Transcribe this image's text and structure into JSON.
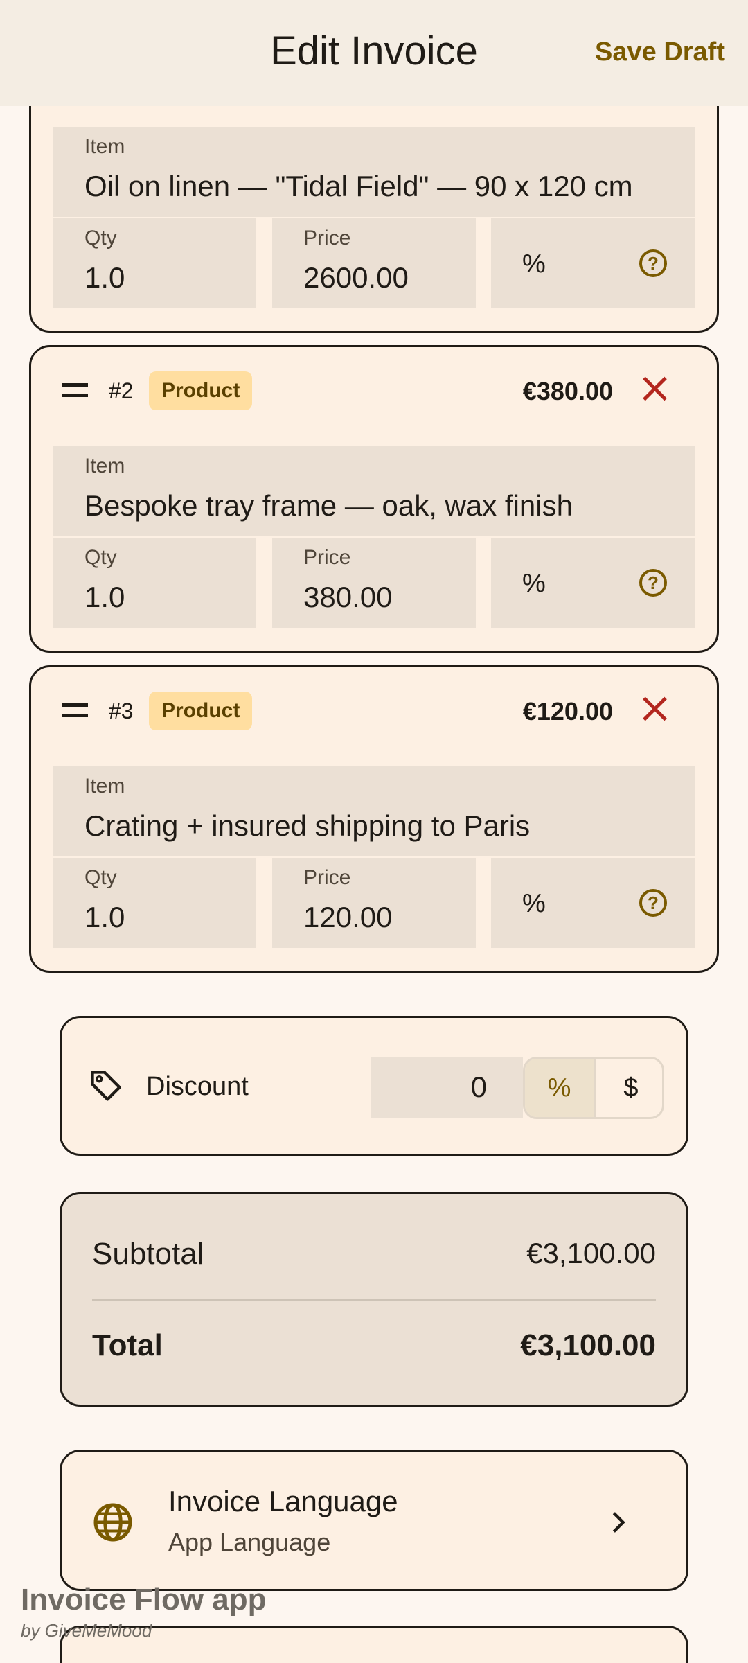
{
  "appbar": {
    "title": "Edit Invoice",
    "save_label": "Save Draft"
  },
  "items": [
    {
      "number": "",
      "badge": "",
      "amount": "",
      "item_label": "Item",
      "item_value": "Oil on linen — \"Tidal Field\" — 90 x 120 cm",
      "qty_label": "Qty",
      "qty_value": "1.0",
      "price_label": "Price",
      "price_value": "2600.00",
      "pct_symbol": "%"
    },
    {
      "number": "#2",
      "badge": "Product",
      "amount": "€380.00",
      "item_label": "Item",
      "item_value": "Bespoke tray frame — oak, wax finish",
      "qty_label": "Qty",
      "qty_value": "1.0",
      "price_label": "Price",
      "price_value": "380.00",
      "pct_symbol": "%"
    },
    {
      "number": "#3",
      "badge": "Product",
      "amount": "€120.00",
      "item_label": "Item",
      "item_value": "Crating + insured shipping to Paris",
      "qty_label": "Qty",
      "qty_value": "1.0",
      "price_label": "Price",
      "price_value": "120.00",
      "pct_symbol": "%"
    }
  ],
  "discount": {
    "label": "Discount",
    "value": "0",
    "option_percent": "%",
    "option_dollar": "$",
    "selected": "%",
    "icon": "tag-icon"
  },
  "totals": {
    "subtotal_label": "Subtotal",
    "subtotal_value": "€3,100.00",
    "total_label": "Total",
    "total_value": "€3,100.00"
  },
  "language": {
    "title": "Invoice Language",
    "subtitle": "App Language",
    "icon": "globe-icon"
  },
  "watermark": {
    "brand": "Invoice Flow app",
    "by": "by GiveMeMood"
  },
  "colors": {
    "accent": "#7a5a00",
    "badge_bg": "#ffdea0",
    "delete": "#b3261e",
    "card_bg": "#fdf0e3",
    "field_bg": "#ebe0d4"
  }
}
